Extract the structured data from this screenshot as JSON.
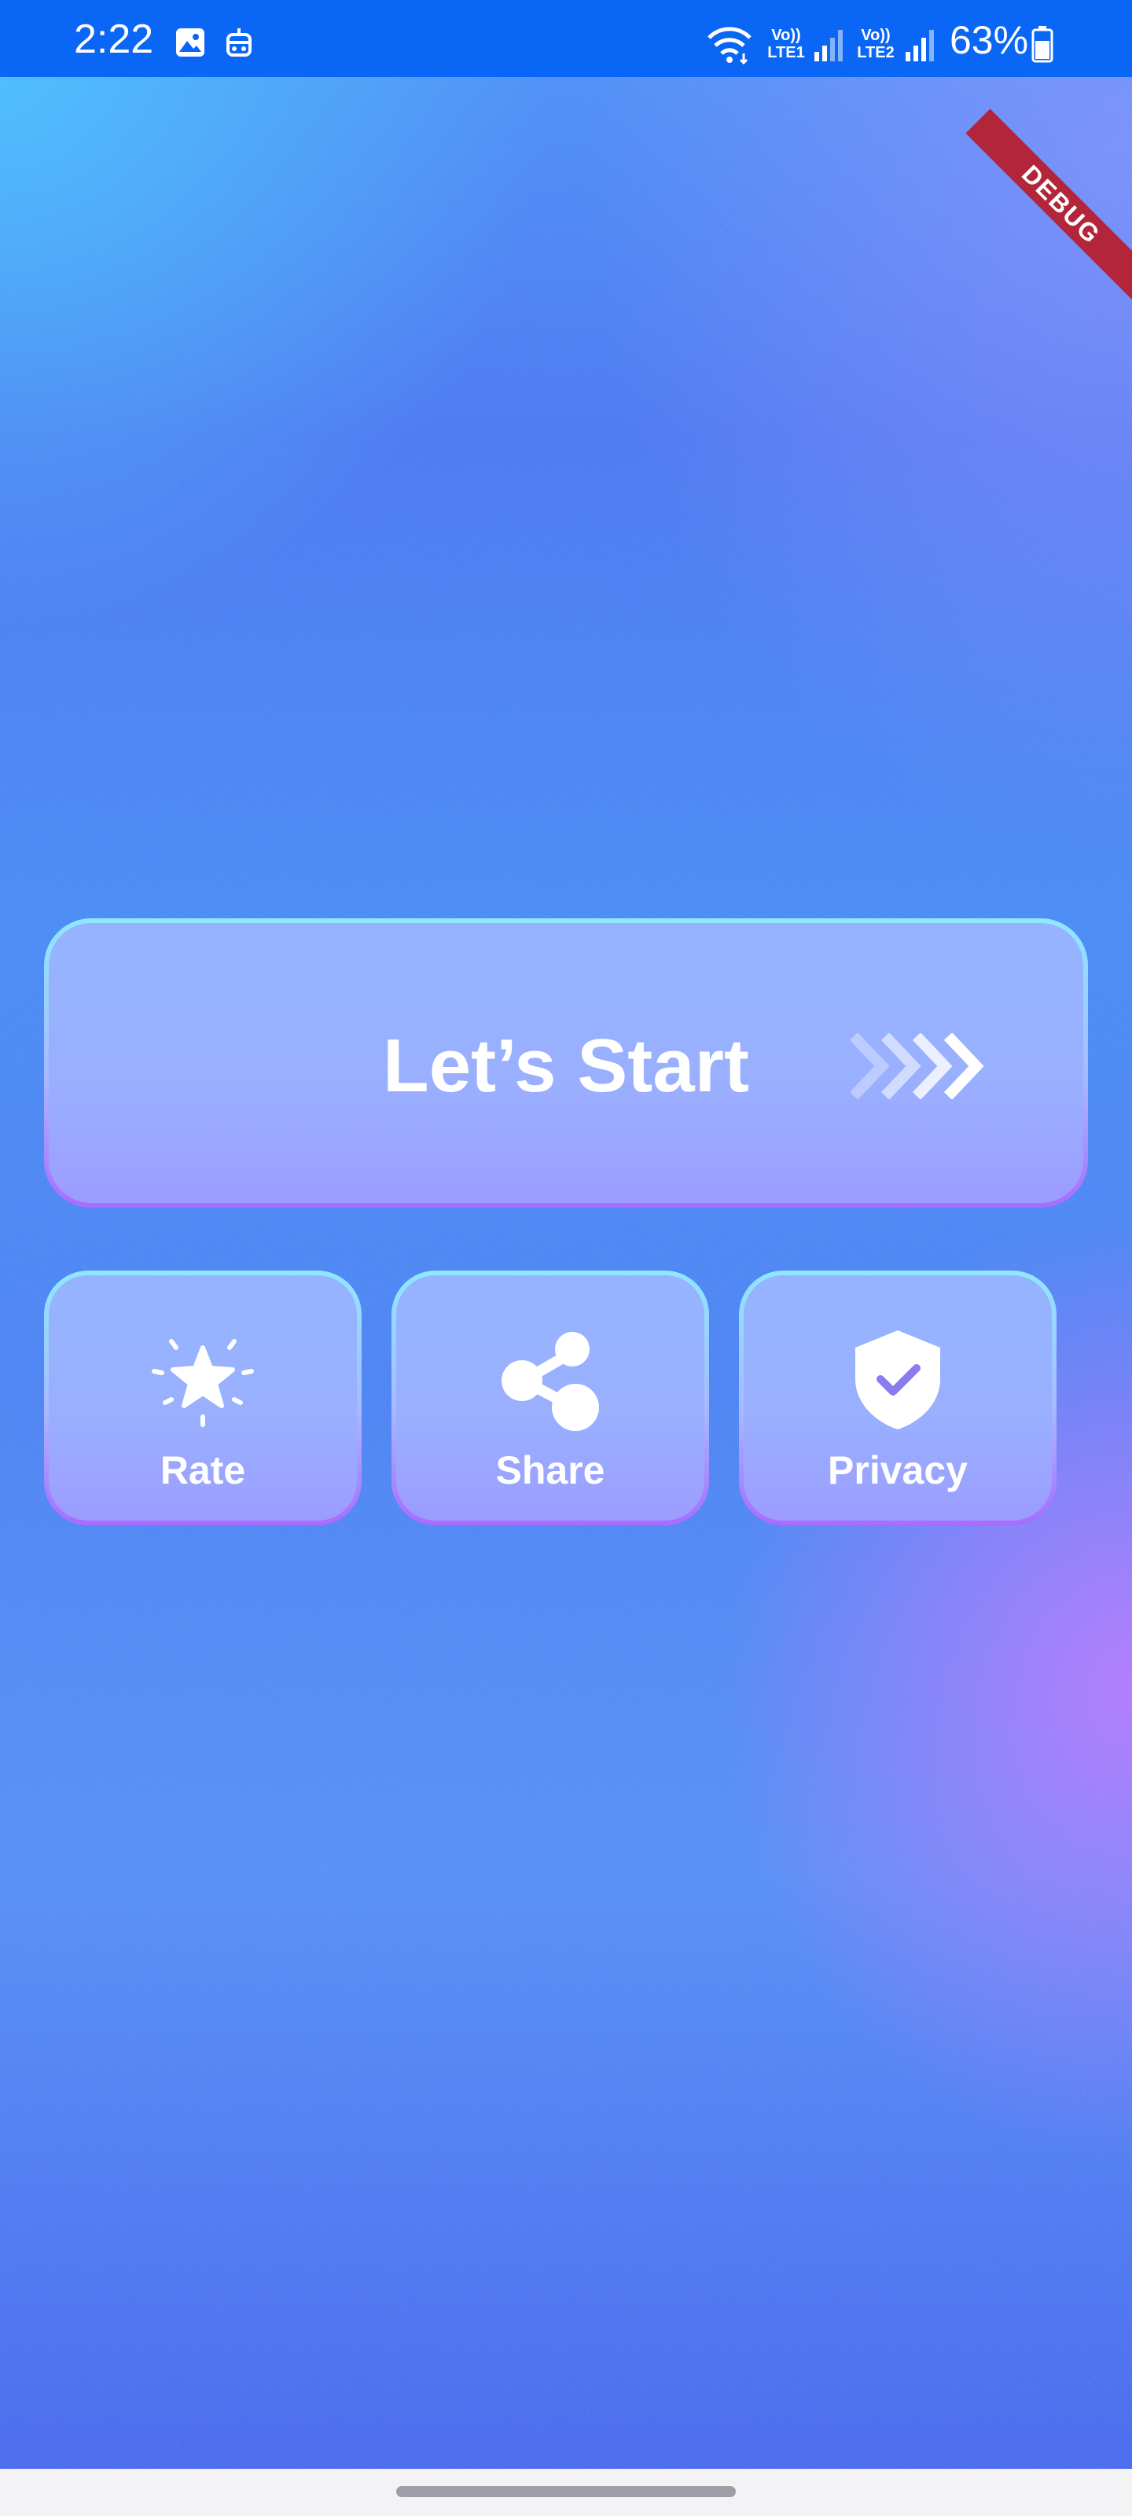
{
  "status_bar": {
    "time": "2:22",
    "sim1_label": "Vo))\nLTE1",
    "sim2_label": "Vo))\nLTE2",
    "battery": "63%",
    "icons": [
      "gallery-icon",
      "bot-icon",
      "wifi-icon",
      "signal-icon",
      "battery-icon"
    ]
  },
  "debug_banner": "DEBUG",
  "main": {
    "start_button": {
      "label": "Let’s Start",
      "icon": "chevrons-right-icon"
    },
    "tiles": [
      {
        "label": "Rate",
        "icon": "star-burst-icon"
      },
      {
        "label": "Share",
        "icon": "share-icon"
      },
      {
        "label": "Privacy",
        "icon": "shield-check-icon"
      }
    ]
  },
  "colors": {
    "status_bar": "#0a66f5",
    "accent_purple": "#a96bff",
    "accent_cyan": "#8fe8ff",
    "text": "#ffffff"
  }
}
